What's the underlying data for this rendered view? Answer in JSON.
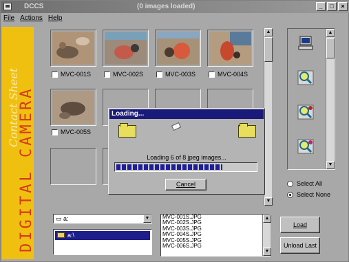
{
  "window": {
    "app_name": "DCCS",
    "status_title": "(0 images loaded)",
    "controls": {
      "minimize": "_",
      "maximize": "□",
      "close": "×"
    }
  },
  "menu": {
    "file": "File",
    "actions": "Actions",
    "help": "Help"
  },
  "sidebar": {
    "brand": "DIGITAL CAMERA",
    "product": "Contact Sheet"
  },
  "thumbnails": [
    {
      "label": "MVC-001S",
      "checked": false
    },
    {
      "label": "MVC-002S",
      "checked": false
    },
    {
      "label": "MVC-003S",
      "checked": false
    },
    {
      "label": "MVC-004S",
      "checked": false
    },
    {
      "label": "MVC-005S",
      "checked": false
    }
  ],
  "selection": {
    "select_all": "Select All",
    "select_none": "Select None",
    "selected": "select_none"
  },
  "drive": {
    "value": "a:"
  },
  "directory": {
    "selected": "a:\\"
  },
  "files": [
    "MVC-001S.JPG",
    "MVC-002S.JPG",
    "MVC-003S.JPG",
    "MVC-004S.JPG",
    "MVC-005S.JPG",
    "MVC-006S.JPG"
  ],
  "buttons": {
    "load": "Load",
    "unload_last": "Unload Last"
  },
  "dialog": {
    "title": "Loading...",
    "message": "Loading  6   of 8 jpeg images...",
    "progress": 0.76,
    "cancel": "Cancel"
  },
  "colors": {
    "sidebar_bg": "#f0c010",
    "sidebar_text": "#d63a1a",
    "titlebar": "#7a7a7a",
    "dialog_title": "#1a1a7a",
    "progress_fill": "#1e1e9a"
  },
  "icons": {
    "tools": [
      "computer-icon",
      "magnify-icon",
      "magnify-zoom-icon",
      "magnify-zoom-alt-icon"
    ]
  }
}
